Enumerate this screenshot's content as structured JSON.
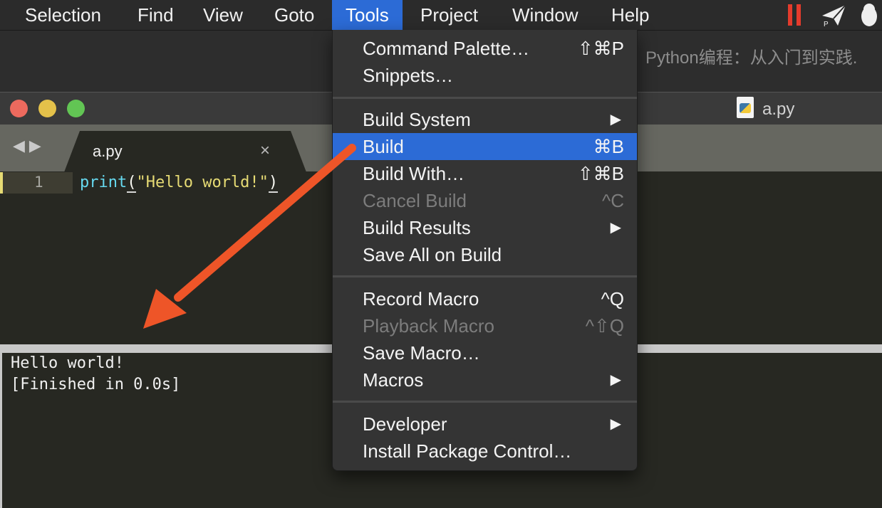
{
  "menubar": {
    "items": [
      "Selection",
      "Find",
      "View",
      "Goto",
      "Tools",
      "Project",
      "Window",
      "Help"
    ],
    "active": "Tools"
  },
  "desktop_window_title": "Python编程：从入门到实践.",
  "window": {
    "title": "a.py"
  },
  "tab": {
    "label": "a.py",
    "close": "×"
  },
  "editor": {
    "line_number": "1",
    "code": {
      "fn": "print",
      "open": "(",
      "str": "\"Hello world!\"",
      "close": ")"
    }
  },
  "output": {
    "lines": [
      "Hello world!",
      "[Finished in 0.0s]"
    ]
  },
  "tools_menu": {
    "groups": [
      [
        {
          "label": "Command Palette…",
          "shortcut": "⇧⌘P"
        },
        {
          "label": "Snippets…",
          "shortcut": ""
        }
      ],
      [
        {
          "label": "Build System",
          "submenu": "▶"
        },
        {
          "label": "Build",
          "shortcut": "⌘B",
          "highlighted": true
        },
        {
          "label": "Build With…",
          "shortcut": "⇧⌘B"
        },
        {
          "label": "Cancel Build",
          "shortcut": "^C",
          "disabled": true
        },
        {
          "label": "Build Results",
          "submenu": "▶"
        },
        {
          "label": "Save All on Build",
          "shortcut": ""
        }
      ],
      [
        {
          "label": "Record Macro",
          "shortcut": "^Q"
        },
        {
          "label": "Playback Macro",
          "shortcut": "^⇧Q",
          "disabled": true
        },
        {
          "label": "Save Macro…",
          "shortcut": ""
        },
        {
          "label": "Macros",
          "submenu": "▶"
        }
      ],
      [
        {
          "label": "Developer",
          "submenu": "▶"
        },
        {
          "label": "Install Package Control…",
          "shortcut": ""
        }
      ]
    ]
  },
  "colors": {
    "accent": "#2c6bd6",
    "annotation_arrow": "#ee5528",
    "editor_bg": "#272822"
  },
  "icons": [
    "pause-icon",
    "paper-plane-icon",
    "qq-penguin-icon",
    "python-file-icon"
  ]
}
